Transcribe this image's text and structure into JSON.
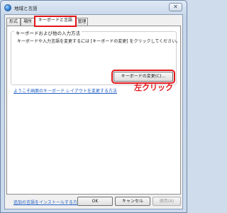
{
  "window": {
    "title": "地域と言語",
    "close_symbol": "✕"
  },
  "tabs": [
    {
      "label": "形式"
    },
    {
      "label": "場所"
    },
    {
      "label": "キーボードと言語",
      "selected": true
    },
    {
      "label": "管理"
    }
  ],
  "keyboards_group": {
    "title": "キーボードおよび他の入力方法",
    "description": "キーボードや入力言語を変更するには [キーボードの変更] をクリックしてください。",
    "change_button": "キーボードの変更(C)..."
  },
  "screen_keyboard_link": "ようこそ画面のキーボード レイアウトを変更する方法",
  "annotation": {
    "text": "左クリック",
    "color": "#e0161b"
  },
  "install_link": "追加の言語をインストールする方法",
  "buttons": {
    "ok": "OK",
    "cancel": "キャンセル",
    "apply": "適用(A)"
  },
  "colors": {
    "accent_red": "#e0161b",
    "link_blue": "#1f5ec4"
  }
}
